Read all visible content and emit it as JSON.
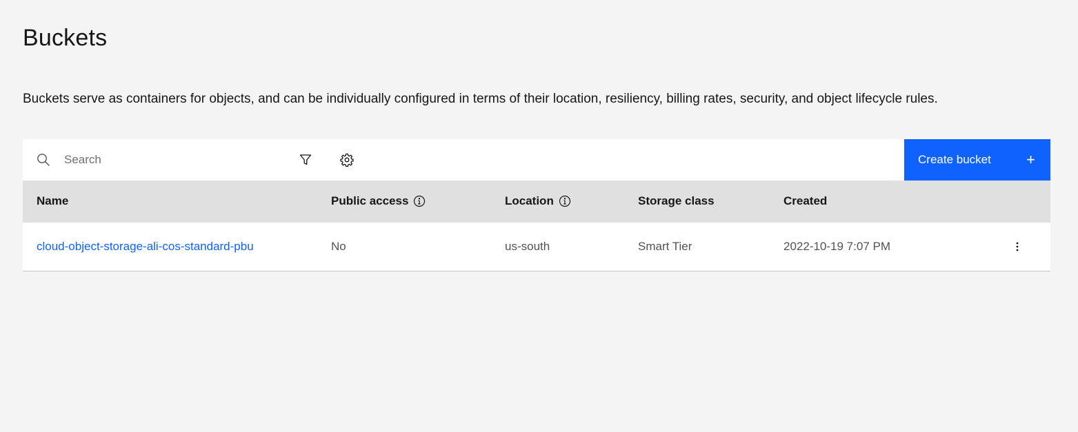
{
  "page": {
    "title": "Buckets",
    "description": "Buckets serve as containers for objects, and can be individually configured in terms of their location, resiliency, billing rates, security, and object lifecycle rules."
  },
  "toolbar": {
    "search_placeholder": "Search",
    "search_icon": "search-icon",
    "filter_icon": "filter-icon",
    "settings_icon": "gear-icon",
    "create_label": "Create bucket",
    "create_icon": "+"
  },
  "table": {
    "columns": [
      "Name",
      "Public access",
      "Location",
      "Storage class",
      "Created"
    ],
    "rows": [
      {
        "name": "cloud-object-storage-ali-cos-standard-pbu",
        "public_access": "No",
        "location": "us-south",
        "storage_class": "Smart Tier",
        "created": "2022-10-19 7:07 PM"
      }
    ]
  },
  "colors": {
    "accent": "#0f62fe",
    "background": "#f4f4f4",
    "header_bg": "#e0e0e0"
  }
}
